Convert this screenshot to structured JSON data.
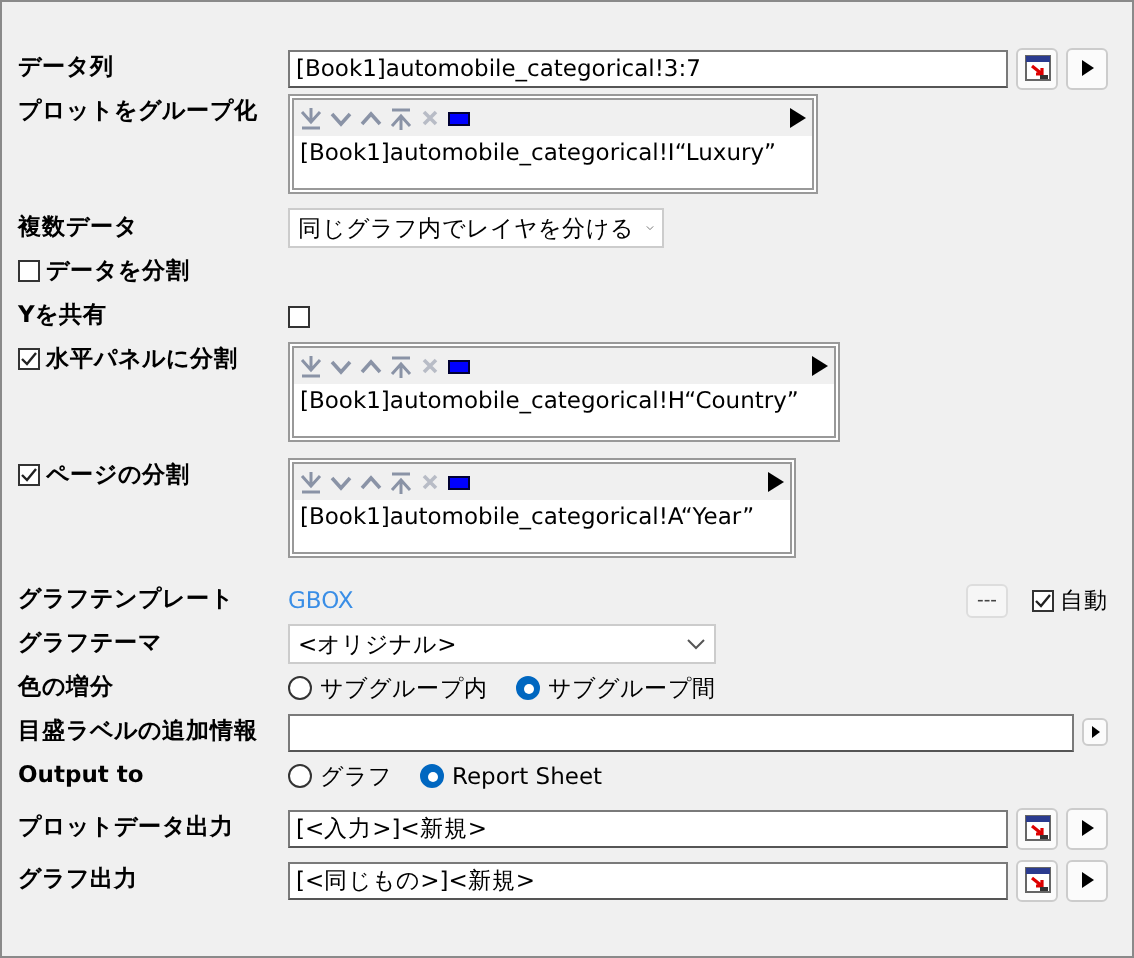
{
  "rows": [
    {
      "kind": "field",
      "label": "データ列",
      "value": "[Book1]automobile_categorical!3:7"
    },
    {
      "kind": "listbox",
      "label": "プロットをグループ化",
      "items": [
        "[Book1]automobile_categorical!I“Luxury”"
      ]
    },
    {
      "kind": "dropdown",
      "label": "複数データ",
      "value": "同じグラフ内でレイヤを分ける"
    },
    {
      "kind": "checkbox_label",
      "label": "データを分割",
      "checked": false
    },
    {
      "kind": "checkbox_value",
      "label": "Yを共有",
      "checked": false
    },
    {
      "kind": "listbox",
      "label": "水平パネルに分割",
      "checked": true,
      "items": [
        "[Book1]automobile_categorical!H“Country”"
      ]
    },
    {
      "kind": "listbox",
      "label": "ページの分割",
      "checked": true,
      "items": [
        "[Book1]automobile_categorical!A“Year”"
      ]
    },
    {
      "kind": "template",
      "label": "グラフテンプレート",
      "link": "GBOX",
      "button": "---",
      "auto": {
        "label": "自動",
        "checked": true
      }
    },
    {
      "kind": "dropdown",
      "label": "グラフテーマ",
      "value": "<オリジナル>"
    },
    {
      "kind": "radio",
      "label": "色の増分",
      "options": [
        {
          "label": "サブグループ内",
          "selected": false
        },
        {
          "label": "サブグループ間",
          "selected": true
        }
      ]
    },
    {
      "kind": "field_small",
      "label": "目盛ラベルの追加情報"
    },
    {
      "kind": "radio",
      "label": "Output to",
      "options": [
        {
          "label": "グラフ",
          "selected": false
        },
        {
          "label": "Report Sheet",
          "selected": true
        }
      ]
    },
    {
      "kind": "field",
      "label": "プロットデータ出力",
      "value": "[<入力>]<新規>"
    },
    {
      "kind": "field",
      "label": "グラフ出力",
      "value": "[<同じもの>]<新規>"
    }
  ]
}
